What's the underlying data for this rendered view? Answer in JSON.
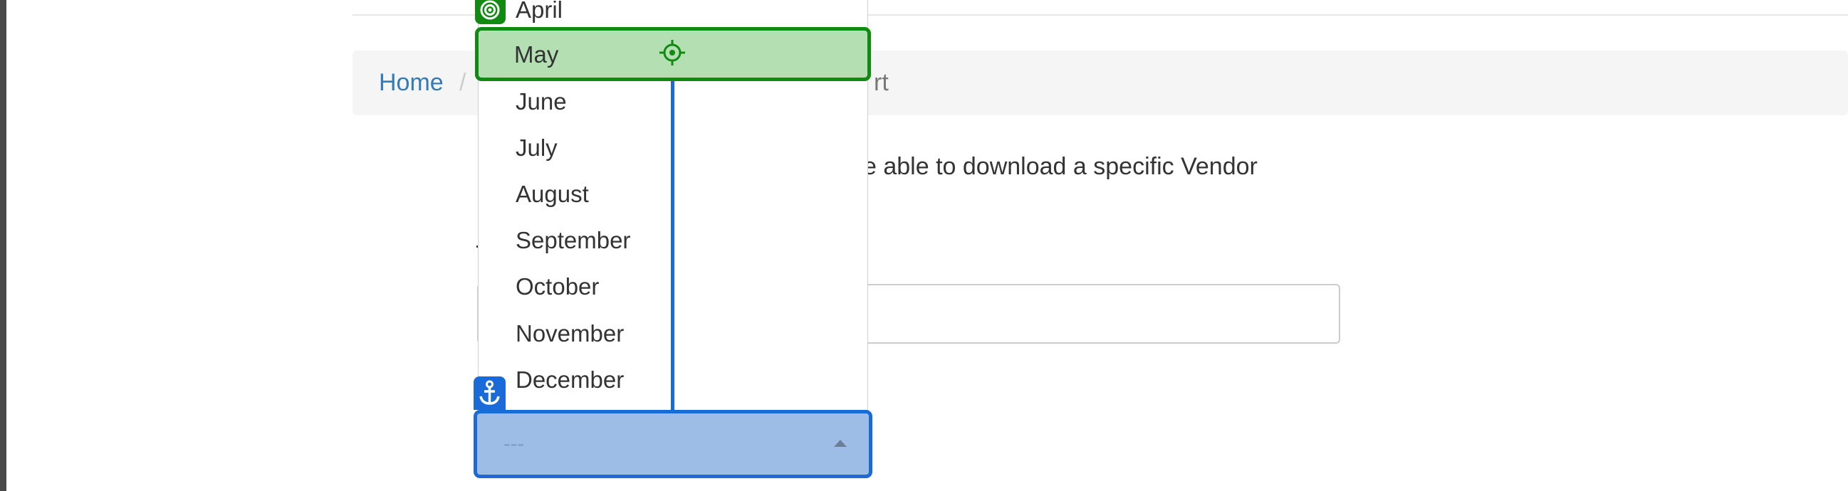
{
  "breadcrumb": {
    "home_label": "Home",
    "separator": "/",
    "current_partial": "rt"
  },
  "main": {
    "description_partial": "e able to download a specific Vendor",
    "vendor_input_value": ""
  },
  "month_dropdown": {
    "options": [
      "April",
      "May",
      "June",
      "July",
      "August",
      "September",
      "October",
      "November",
      "December"
    ],
    "highlighted_option": "May",
    "selected_value": "---"
  },
  "overlay": {
    "target_icon": "target-icon",
    "crosshair_icon": "crosshair-icon",
    "anchor_icon": "anchor-icon",
    "target_color": "#108a10",
    "anchor_color": "#1a6bd8"
  }
}
